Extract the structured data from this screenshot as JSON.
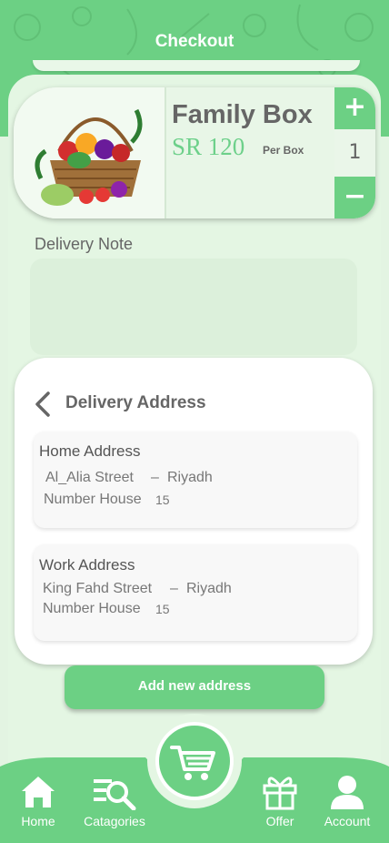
{
  "header": {
    "title": "Checkout"
  },
  "product": {
    "name": "Family Box",
    "price": "SR 120",
    "unit": "Per Box",
    "quantity": "1",
    "plus": "+",
    "minus": "−"
  },
  "delivery_note": {
    "label": "Delivery Note",
    "value": ""
  },
  "address_panel": {
    "title": "Delivery Address",
    "addresses": [
      {
        "label": "Home Address",
        "street": "Al_Alia Street",
        "sep": "–",
        "city": "Riyadh",
        "house_label": "Number House",
        "house_no": "15"
      },
      {
        "label": "Work  Address",
        "street": "King Fahd Street",
        "sep": "–",
        "city": "Riyadh",
        "house_label": "Number House",
        "house_no": "15"
      }
    ]
  },
  "add_address": {
    "label": "Add new address"
  },
  "nav": {
    "items": [
      {
        "label": "Home",
        "icon": "home-icon"
      },
      {
        "label": "Catagories",
        "icon": "search-list-icon"
      },
      {
        "label": "Offer",
        "icon": "gift-icon"
      },
      {
        "label": "Account",
        "icon": "user-icon"
      }
    ],
    "cart_icon": "cart-icon"
  },
  "colors": {
    "accent": "#6cd084",
    "background": "#e3f4e2",
    "text": "#666666"
  }
}
